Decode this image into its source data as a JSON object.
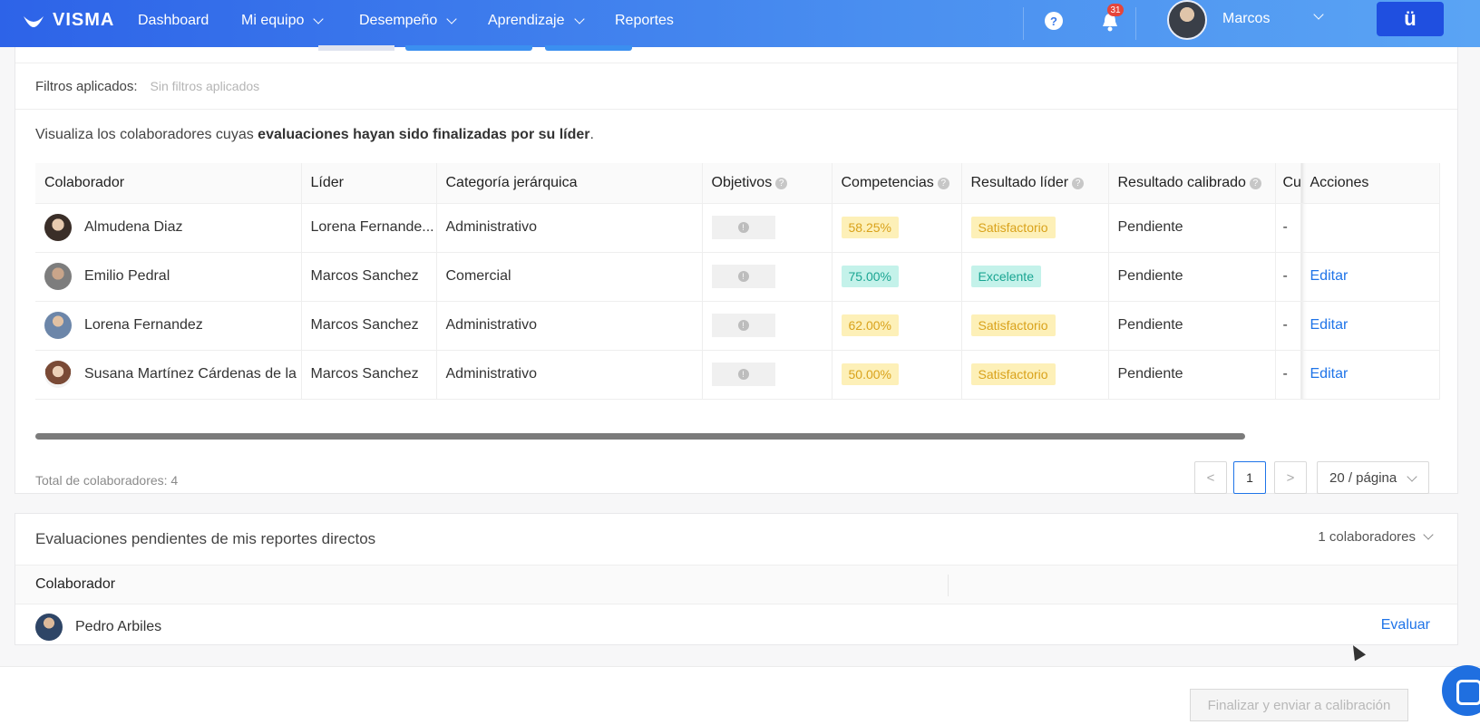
{
  "nav": {
    "logo": "VISMA",
    "items": [
      {
        "label": "Dashboard",
        "dropdown": false
      },
      {
        "label": "Mi equipo",
        "dropdown": true
      },
      {
        "label": "Desempeño",
        "dropdown": true
      },
      {
        "label": "Aprendizaje",
        "dropdown": true
      },
      {
        "label": "Reportes",
        "dropdown": false
      }
    ],
    "help_icon": "question-icon",
    "notifications": {
      "icon": "bell-icon",
      "count": "31"
    },
    "user_name": "Marcos",
    "app_button_glyph": "ü"
  },
  "filters": {
    "label": "Filtros aplicados:",
    "value": "Sin filtros aplicados"
  },
  "description": {
    "prefix": "Visualiza los colaboradores cuyas ",
    "bold": "evaluaciones hayan sido finalizadas por su líder",
    "suffix": "."
  },
  "table": {
    "columns": [
      "Colaborador",
      "Líder",
      "Categoría jerárquica",
      "Objetivos",
      "Competencias",
      "Resultado líder",
      "Resultado calibrado",
      "Cu",
      "Acciones"
    ],
    "rows": [
      {
        "colaborador": "Almudena Diaz",
        "lider": "Lorena Fernande...",
        "categoria": "Administrativo",
        "competencias": "58.25%",
        "resultado_lider": "Satisfactorio",
        "resultado_calibrado": "Pendiente",
        "cu": "-",
        "accion": ""
      },
      {
        "colaborador": "Emilio Pedral",
        "lider": "Marcos Sanchez",
        "categoria": "Comercial",
        "competencias": "75.00%",
        "resultado_lider": "Excelente",
        "resultado_calibrado": "Pendiente",
        "cu": "-",
        "accion": "Editar"
      },
      {
        "colaborador": "Lorena Fernandez",
        "lider": "Marcos Sanchez",
        "categoria": "Administrativo",
        "competencias": "62.00%",
        "resultado_lider": "Satisfactorio",
        "resultado_calibrado": "Pendiente",
        "cu": "-",
        "accion": "Editar"
      },
      {
        "colaborador": "Susana Martínez Cárdenas de la ...",
        "lider": "Marcos Sanchez",
        "categoria": "Administrativo",
        "competencias": "50.00%",
        "resultado_lider": "Satisfactorio",
        "resultado_calibrado": "Pendiente",
        "cu": "-",
        "accion": "Editar"
      }
    ]
  },
  "pagination": {
    "total": "Total de colaboradores: 4",
    "prev": "<",
    "current": "1",
    "next": ">",
    "page_size": "20 / página"
  },
  "pending": {
    "title": "Evaluaciones pendientes de mis reportes directos",
    "count": "1 colaboradores",
    "column": "Colaborador",
    "rows": [
      {
        "colaborador": "Pedro Arbiles",
        "accion": "Evaluar"
      }
    ]
  },
  "footer": {
    "finalize_button": "Finalizar y enviar a calibración"
  },
  "colors": {
    "nav_gradient_start": "#2d63e8",
    "nav_gradient_end": "#5aa4f4",
    "link": "#1f74e8",
    "tag_yellow_bg": "#fdf0b8",
    "tag_teal_bg": "#c4f2ea"
  }
}
